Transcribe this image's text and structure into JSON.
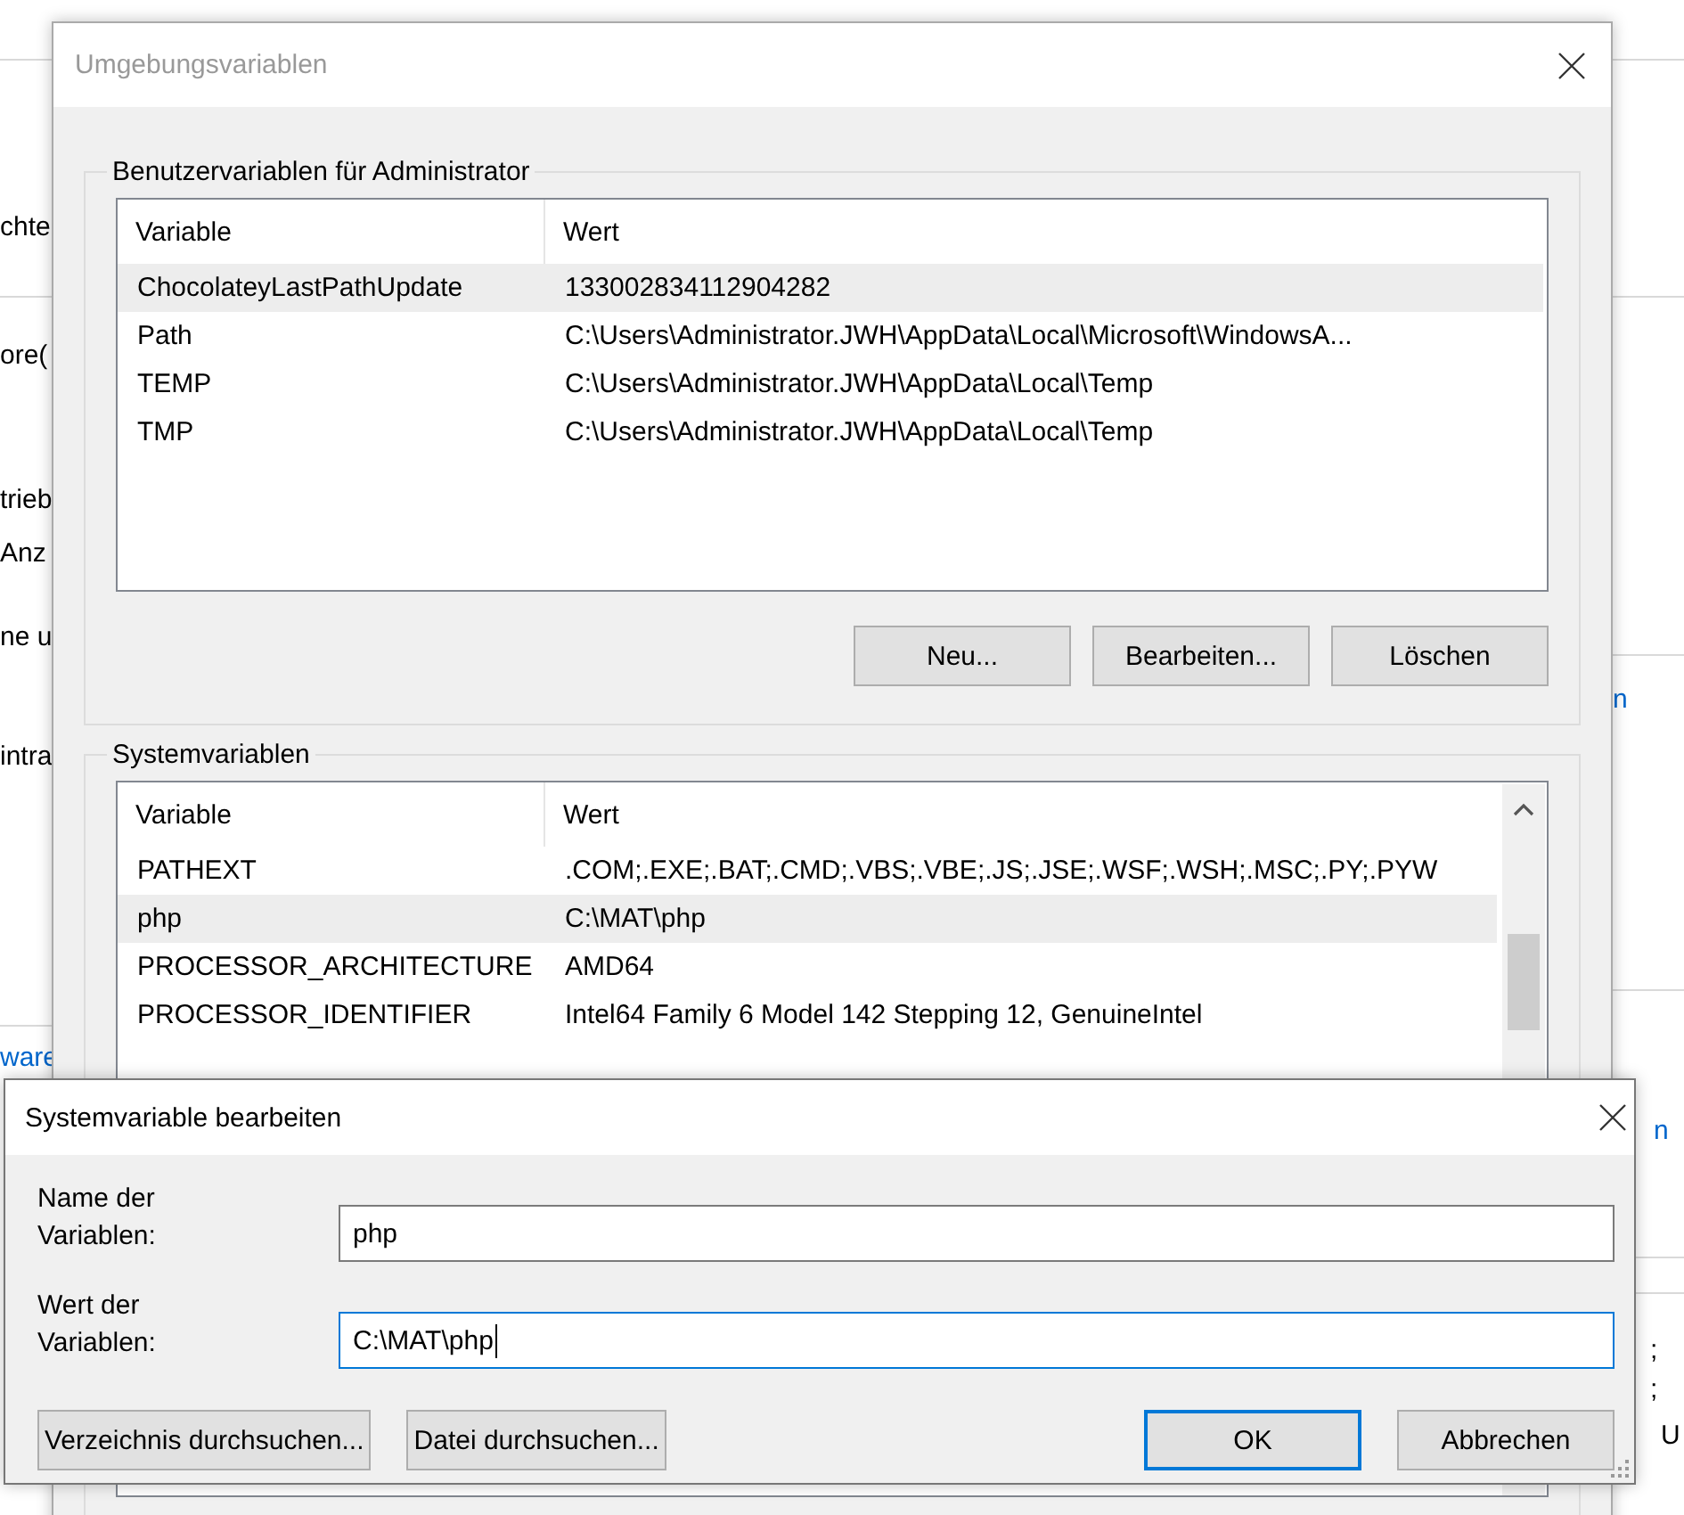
{
  "background": {
    "left_fragments": [
      {
        "text": "chte",
        "kind": "text"
      },
      {
        "text": "ore(",
        "kind": "text"
      },
      {
        "text": "trieb",
        "kind": "text"
      },
      {
        "text": "Anz",
        "kind": "text"
      },
      {
        "text": "ne u",
        "kind": "text"
      },
      {
        "text": "intra",
        "kind": "text"
      },
      {
        "text": "ware",
        "kind": "link"
      }
    ],
    "right_fragments": [
      {
        "text": "n",
        "kind": "link"
      },
      {
        "text": "n",
        "kind": "link"
      },
      {
        "text": ";",
        "kind": "text"
      },
      {
        "text": ";",
        "kind": "text"
      },
      {
        "text": "U",
        "kind": "text"
      }
    ]
  },
  "main_dialog": {
    "title": "Umgebungsvariablen",
    "active": false,
    "user_variables": {
      "title": "Benutzervariablen für Administrator",
      "columns": [
        "Variable",
        "Wert"
      ],
      "rows": [
        {
          "variable": "ChocolateyLastPathUpdate",
          "value": "133002834112904282",
          "selected": true
        },
        {
          "variable": "Path",
          "value": "C:\\Users\\Administrator.JWH\\AppData\\Local\\Microsoft\\WindowsA...",
          "selected": false
        },
        {
          "variable": "TEMP",
          "value": "C:\\Users\\Administrator.JWH\\AppData\\Local\\Temp",
          "selected": false
        },
        {
          "variable": "TMP",
          "value": "C:\\Users\\Administrator.JWH\\AppData\\Local\\Temp",
          "selected": false
        }
      ],
      "buttons": [
        "Neu...",
        "Bearbeiten...",
        "Löschen"
      ]
    },
    "system_variables": {
      "title": "Systemvariablen",
      "columns": [
        "Variable",
        "Wert"
      ],
      "rows": [
        {
          "variable": "PATHEXT",
          "value": ".COM;.EXE;.BAT;.CMD;.VBS;.VBE;.JS;.JSE;.WSF;.WSH;.MSC;.PY;.PYW",
          "selected": false
        },
        {
          "variable": "php",
          "value": "C:\\MAT\\php",
          "selected": true
        },
        {
          "variable": "PROCESSOR_ARCHITECTURE",
          "value": "AMD64",
          "selected": false
        },
        {
          "variable": "PROCESSOR_IDENTIFIER",
          "value": "Intel64 Family 6 Model 142 Stepping 12, GenuineIntel",
          "selected": false
        }
      ]
    }
  },
  "edit_dialog": {
    "title": "Systemvariable bearbeiten",
    "fields": [
      {
        "label": "Name der Variablen:",
        "value": "php",
        "focused": false
      },
      {
        "label": "Wert der Variablen:",
        "value": "C:\\MAT\\php",
        "focused": true
      }
    ],
    "buttons": [
      {
        "label": "Verzeichnis durchsuchen...",
        "default": false
      },
      {
        "label": "Datei durchsuchen...",
        "default": false
      },
      {
        "label": "OK",
        "default": true
      },
      {
        "label": "Abbrechen",
        "default": false
      }
    ]
  }
}
